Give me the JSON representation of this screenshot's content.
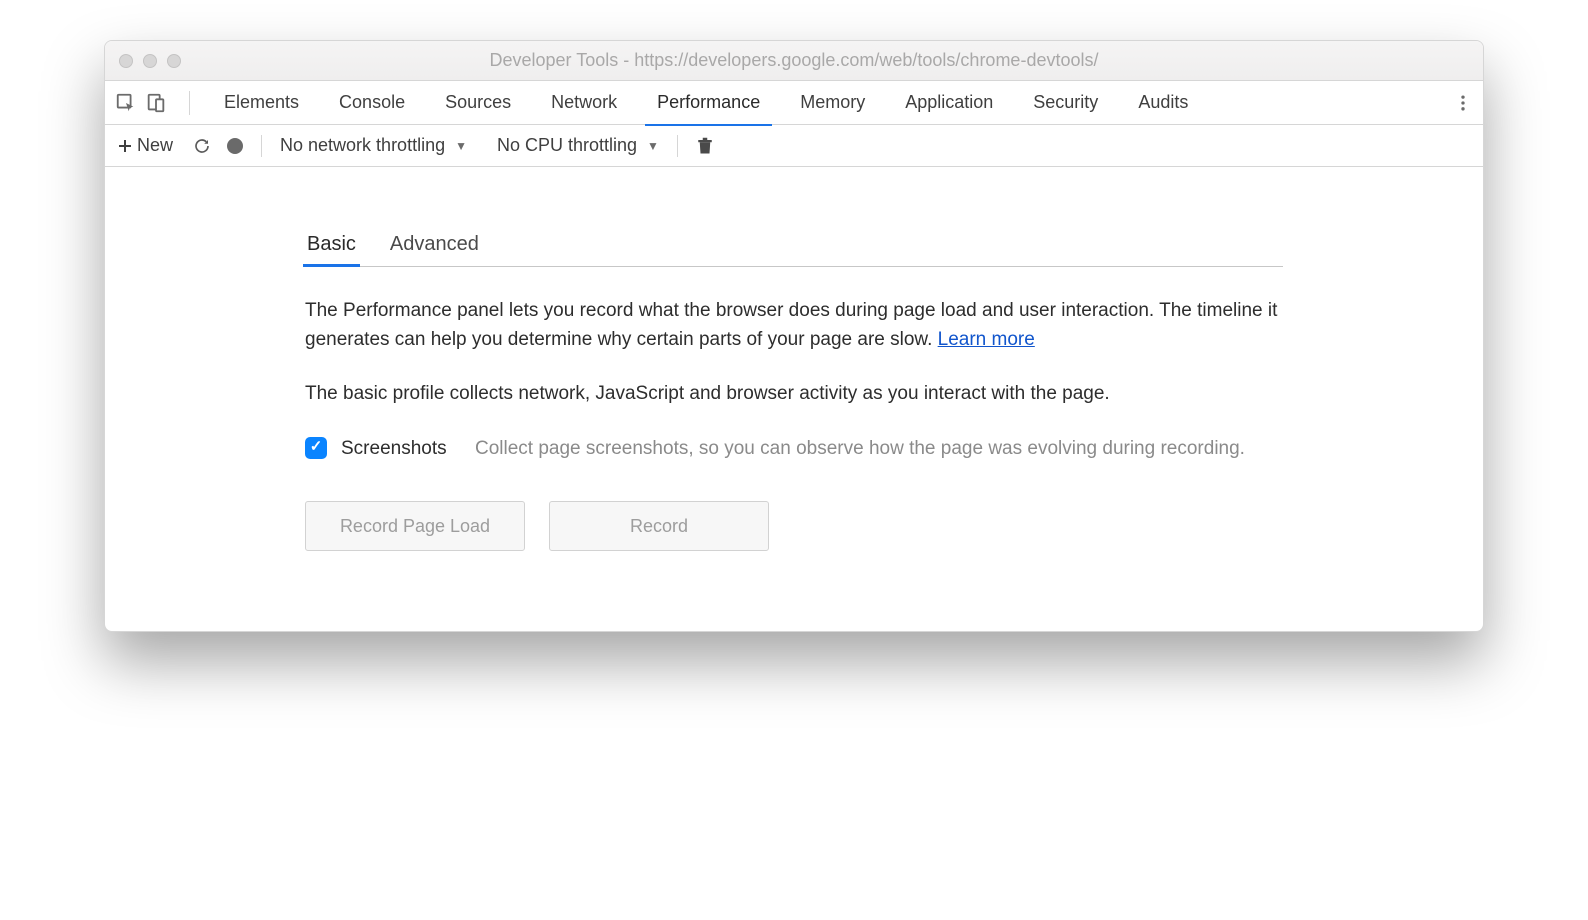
{
  "window": {
    "title": "Developer Tools - https://developers.google.com/web/tools/chrome-devtools/"
  },
  "tabs": {
    "items": [
      "Elements",
      "Console",
      "Sources",
      "Network",
      "Performance",
      "Memory",
      "Application",
      "Security",
      "Audits"
    ],
    "active_index": 4
  },
  "toolbar": {
    "new_label": "New",
    "network_throttle": "No network throttling",
    "cpu_throttle": "No CPU throttling"
  },
  "subtabs": {
    "items": [
      "Basic",
      "Advanced"
    ],
    "active_index": 0
  },
  "body": {
    "desc1_a": "The Performance panel lets you record what the browser does during page load and user interaction. The timeline it generates can help you determine why certain parts of your page are slow.  ",
    "learn_more": "Learn more",
    "desc2": "The basic profile collects network, JavaScript and browser activity as you interact with the page.",
    "screenshot_label": "Screenshots",
    "screenshot_desc": "Collect page screenshots, so you can observe how the page was evolving during recording.",
    "screenshot_checked": true,
    "btn_record_page_load": "Record Page Load",
    "btn_record": "Record"
  }
}
